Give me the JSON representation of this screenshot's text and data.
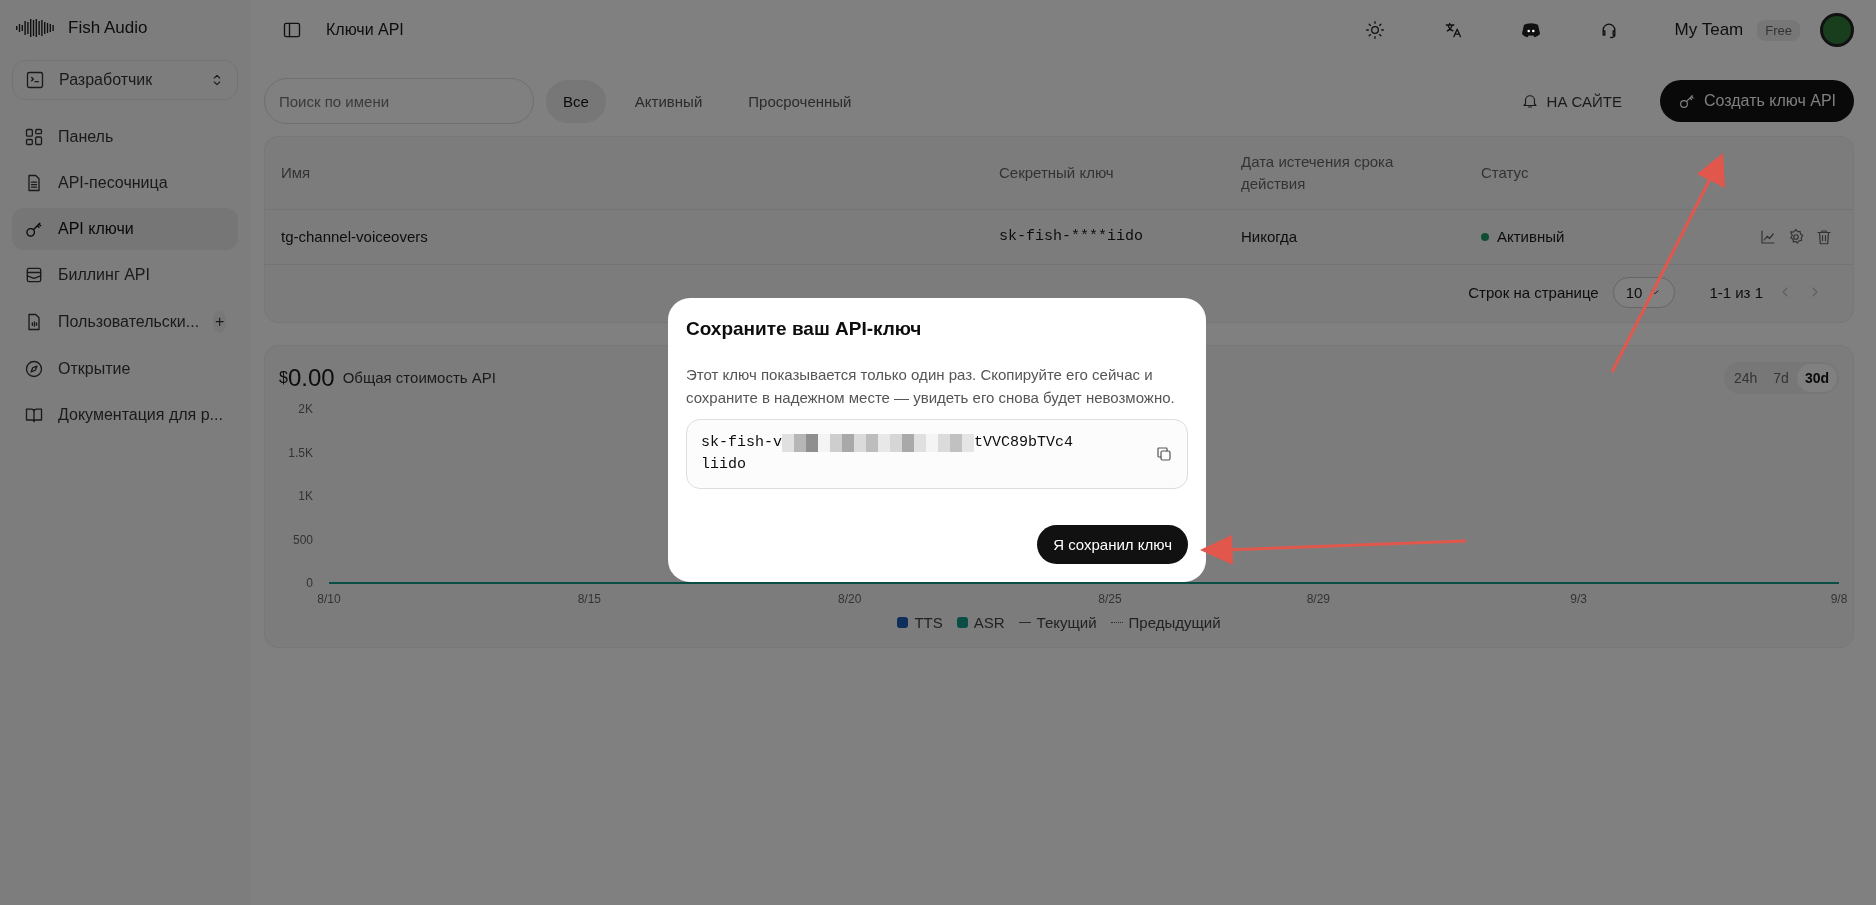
{
  "sidebar": {
    "brand": "Fish Audio",
    "workspace": "Разработчик",
    "items": [
      {
        "label": "Панель",
        "selected": false
      },
      {
        "label": "API-песочница",
        "selected": false
      },
      {
        "label": "API ключи",
        "selected": true
      },
      {
        "label": "Биллинг API",
        "selected": false
      },
      {
        "label": "Пользовательски...",
        "selected": false,
        "action": "+"
      },
      {
        "label": "Открытие",
        "selected": false
      },
      {
        "label": "Документация для р...",
        "selected": false
      }
    ]
  },
  "topbar": {
    "title": "Ключи API",
    "team": "My Team",
    "plan": "Free"
  },
  "toolbar": {
    "search": {
      "placeholder": "Поиск по имени"
    },
    "filters": [
      {
        "label": "Все",
        "selected": true
      },
      {
        "label": "Активный",
        "selected": false
      },
      {
        "label": "Просроченный",
        "selected": false
      }
    ],
    "notify_button": "НА САЙТЕ",
    "create_button": "Создать ключ API"
  },
  "table": {
    "columns": [
      "Имя",
      "Секретный ключ",
      "Дата истечения срока действия",
      "Статус"
    ],
    "rows": [
      {
        "name": "tg-channel-voiceovers",
        "key": "sk-fish-****iido",
        "expires": "Никогда",
        "status": "Активный",
        "color": "#0f4e35"
      }
    ],
    "rows_per_page_label": "Строк на странице",
    "rows_per_page": "10",
    "range": "1-1 из 1"
  },
  "usage": {
    "currency": "$",
    "amount": "0.00",
    "label": "Общая стоимость API",
    "ranges": [
      {
        "label": "24h",
        "selected": false
      },
      {
        "label": "7d",
        "selected": false
      },
      {
        "label": "30d",
        "selected": true
      }
    ],
    "chart_data": {
      "type": "line",
      "categories": [
        "8/10",
        null,
        null,
        null,
        null,
        "8/15",
        null,
        null,
        null,
        null,
        "8/20",
        null,
        null,
        null,
        null,
        "8/25",
        null,
        null,
        null,
        "8/29",
        null,
        null,
        null,
        null,
        "9/3",
        null,
        null,
        null,
        null,
        "9/8"
      ],
      "yticks": [
        {
          "value": 0,
          "label": "0"
        },
        {
          "value": 500,
          "label": "500"
        },
        {
          "value": 1000,
          "label": "1K"
        },
        {
          "value": 1500,
          "label": "1.5K"
        },
        {
          "value": 2000,
          "label": "2K"
        }
      ],
      "ylim": [
        0,
        2000
      ],
      "series": [
        {
          "name": "TTS",
          "color": "#0e2f5a",
          "values": [
            null,
            null,
            null,
            null,
            null,
            null,
            null,
            null,
            null,
            null,
            null,
            null,
            null,
            null,
            null,
            null,
            null,
            null,
            null,
            null,
            null,
            null,
            null,
            null,
            null,
            null,
            null,
            null,
            null,
            null
          ]
        },
        {
          "name": "ASR",
          "color": "#094d45",
          "values": [
            0,
            0,
            0,
            0,
            0,
            0,
            0,
            0,
            0,
            0,
            0,
            0,
            0,
            0,
            0,
            0,
            0,
            0,
            0,
            0,
            0,
            0,
            0,
            0,
            0,
            0,
            0,
            0,
            0,
            0
          ]
        }
      ]
    },
    "legend": [
      {
        "label": "Текущий",
        "kind": "solid"
      },
      {
        "label": "Предыдущий",
        "kind": "dotted"
      }
    ]
  },
  "modal": {
    "title": "Сохраните ваш API-ключ",
    "text": "Этот ключ показывается только один раз. Скопируйте его сейчас и сохраните в надежном месте — увидеть его снова будет невозможно.",
    "key_start": "sk-fish-v",
    "key_end": "tVVC89bTVc4",
    "key_line2": "liido",
    "button": "Я сохранил ключ"
  }
}
